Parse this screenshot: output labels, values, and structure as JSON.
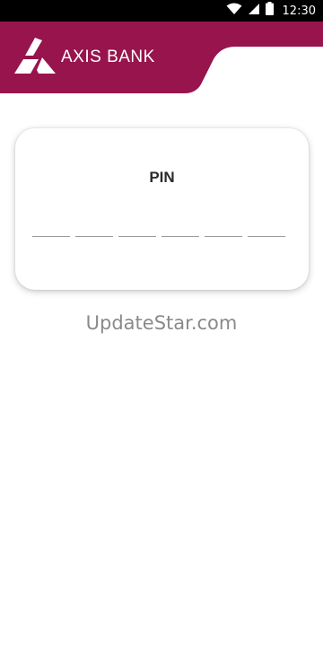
{
  "status_bar": {
    "time": "12:30",
    "icons": [
      "wifi-icon",
      "cellular-signal-icon",
      "battery-icon"
    ]
  },
  "header": {
    "brand_name": "AXIS BANK",
    "logo_icon": "axis-bank-logo-icon",
    "brand_color": "#97144d"
  },
  "pin_card": {
    "label": "PIN",
    "digit_count": 6
  },
  "watermark": {
    "text": "UpdateStar.com"
  }
}
